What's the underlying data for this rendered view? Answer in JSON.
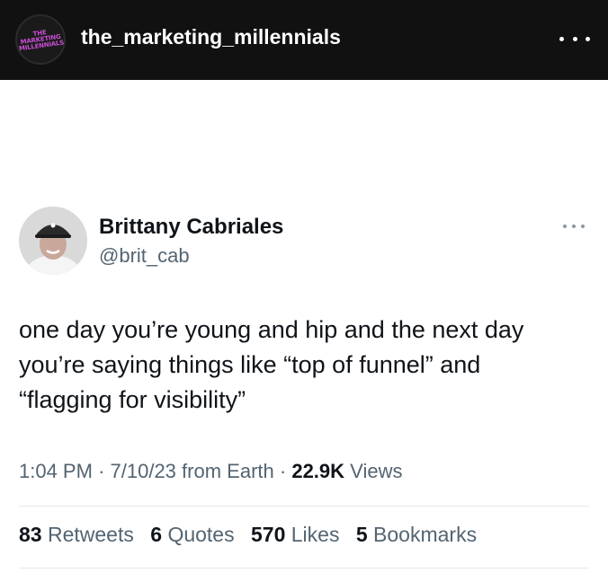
{
  "instagram_header": {
    "account_username": "the_marketing_millennials",
    "avatar_text": [
      "THE",
      "MARKETING",
      "MILLENNIALS"
    ],
    "more_icon": "more-horizontal-icon",
    "background": "#111111"
  },
  "tweet": {
    "author_name": "Brittany Cabriales",
    "author_handle": "@brit_cab",
    "more_icon": "more-horizontal-icon",
    "text_lines": [
      "one day you’re young and hip and the next day",
      "you’re saying things like “top of funnel” and",
      "“flagging for visibility”"
    ],
    "time": "1:04 PM",
    "date": "7/10/23",
    "source": "from Earth",
    "views_count": "22.9K",
    "views_label": "Views",
    "stats": {
      "retweets_count": "83",
      "retweets_label": "Retweets",
      "quotes_count": "6",
      "quotes_label": "Quotes",
      "likes_count": "570",
      "likes_label": "Likes",
      "bookmarks_count": "5",
      "bookmarks_label": "Bookmarks"
    }
  },
  "colors": {
    "primary_text": "#0f1419",
    "secondary_text": "#536471",
    "divider": "#e6e8ea"
  }
}
